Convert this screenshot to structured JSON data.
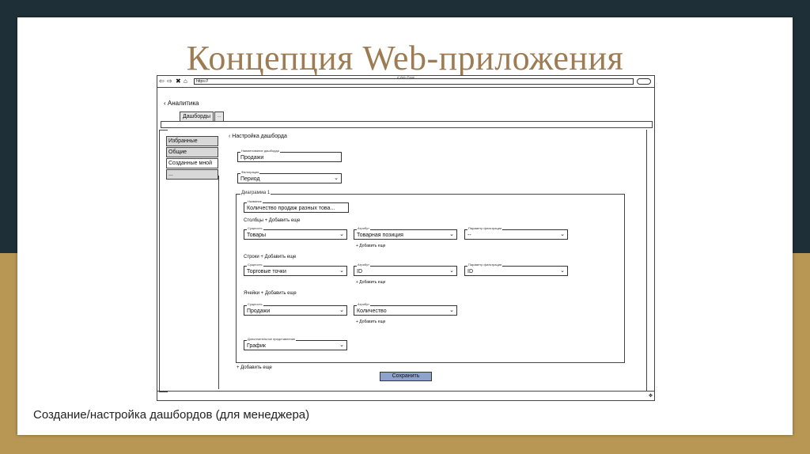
{
  "slide": {
    "title": "Концепция Web-приложения",
    "caption": "Создание/настройка дашбордов (для менеджера)"
  },
  "browser": {
    "page_title": "A Web Page",
    "url": "https://",
    "nav": [
      "⇦",
      "⇨",
      "✖",
      "⌂"
    ]
  },
  "app": {
    "back_label": "Аналитика",
    "tabs": [
      "Дашборды",
      "..."
    ],
    "sidebar": [
      "Избранные",
      "Общие",
      "Созданные мной",
      "..."
    ],
    "panel_title": "Настройка дашборда",
    "name_label": "Наименование дашборда",
    "name_value": "Продажи",
    "filter_label": "Фильтрация",
    "filter_value": "Период",
    "chart_group_label": "Диаграмма 1",
    "chart_name_label": "Название",
    "chart_name_value": "Количество продаж разных това...",
    "columns_label": "Столбцы + Добавить еще",
    "rows_label": "Строки + Добавить еще",
    "cells_label": "Ячейки + Добавить еще",
    "add_more": "+ Добавить еще",
    "dim_label": "Сущность",
    "attr_label": "Атрибут",
    "filter_param_label": "Параметр фильтрации",
    "columns": {
      "dim": "Товары",
      "attr": "Товарная позиция",
      "filter": "--"
    },
    "rows": {
      "dim": "Торговые точки",
      "attr": "ID",
      "filter": "ID"
    },
    "cells": {
      "dim": "Продажи",
      "attr": "Количество"
    },
    "extra_label": "Дополнительное представление",
    "extra_value": "График",
    "add_more_bottom": "+ Добавить еще",
    "save_label": "Сохранить"
  },
  "colors": {
    "title": "#9e7c53",
    "save_button": "#8ea3cc",
    "gold": "#b89654",
    "dark": "#1f2f38"
  }
}
